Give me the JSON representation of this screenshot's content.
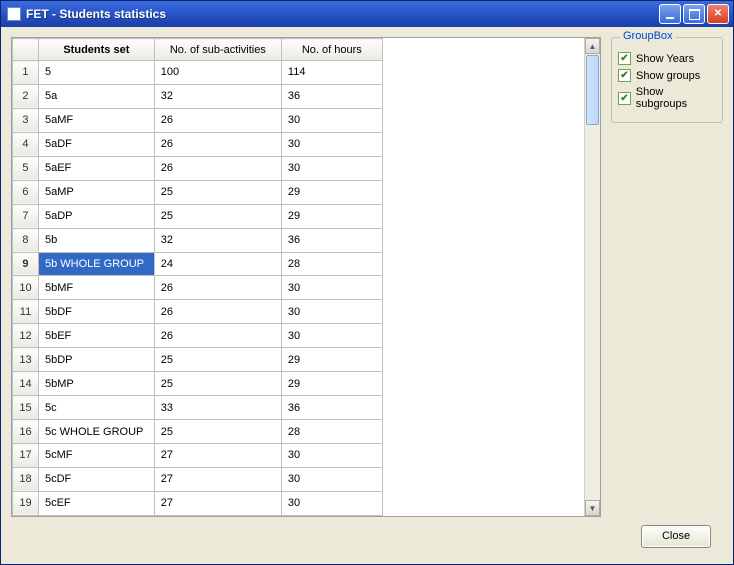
{
  "window": {
    "title": "FET - Students statistics"
  },
  "table": {
    "headers": {
      "set": "Students set",
      "sub": "No. of sub-activities",
      "hours": "No. of hours"
    },
    "selected_index": 8,
    "rows": [
      {
        "n": "1",
        "set": "5",
        "sub": "100",
        "hours": "114"
      },
      {
        "n": "2",
        "set": "5a",
        "sub": "32",
        "hours": "36"
      },
      {
        "n": "3",
        "set": "5aMF",
        "sub": "26",
        "hours": "30"
      },
      {
        "n": "4",
        "set": "5aDF",
        "sub": "26",
        "hours": "30"
      },
      {
        "n": "5",
        "set": "5aEF",
        "sub": "26",
        "hours": "30"
      },
      {
        "n": "6",
        "set": "5aMP",
        "sub": "25",
        "hours": "29"
      },
      {
        "n": "7",
        "set": "5aDP",
        "sub": "25",
        "hours": "29"
      },
      {
        "n": "8",
        "set": "5b",
        "sub": "32",
        "hours": "36"
      },
      {
        "n": "9",
        "set": "5b WHOLE GROUP",
        "sub": "24",
        "hours": "28"
      },
      {
        "n": "10",
        "set": "5bMF",
        "sub": "26",
        "hours": "30"
      },
      {
        "n": "11",
        "set": "5bDF",
        "sub": "26",
        "hours": "30"
      },
      {
        "n": "12",
        "set": "5bEF",
        "sub": "26",
        "hours": "30"
      },
      {
        "n": "13",
        "set": "5bDP",
        "sub": "25",
        "hours": "29"
      },
      {
        "n": "14",
        "set": "5bMP",
        "sub": "25",
        "hours": "29"
      },
      {
        "n": "15",
        "set": "5c",
        "sub": "33",
        "hours": "36"
      },
      {
        "n": "16",
        "set": "5c WHOLE GROUP",
        "sub": "25",
        "hours": "28"
      },
      {
        "n": "17",
        "set": "5cMF",
        "sub": "27",
        "hours": "30"
      },
      {
        "n": "18",
        "set": "5cDF",
        "sub": "27",
        "hours": "30"
      },
      {
        "n": "19",
        "set": "5cEF",
        "sub": "27",
        "hours": "30"
      }
    ]
  },
  "groupbox": {
    "title": "GroupBox",
    "options": {
      "years": {
        "label": "Show Years",
        "checked": true
      },
      "groups": {
        "label": "Show groups",
        "checked": true
      },
      "subgroups": {
        "label": "Show subgroups",
        "checked": true
      }
    }
  },
  "buttons": {
    "close": "Close"
  }
}
